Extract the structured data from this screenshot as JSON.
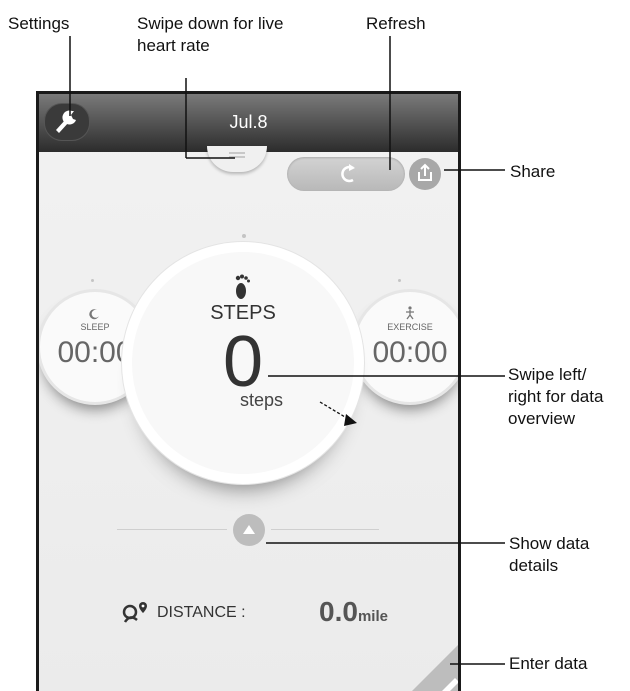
{
  "callouts": {
    "settings": "Settings",
    "swipe_down": "Swipe down for live",
    "swipe_down_2": "heart rate",
    "refresh": "Refresh",
    "share": "Share",
    "swipe_lr_1": "Swipe left/",
    "swipe_lr_2": "right for data",
    "swipe_lr_3": "overview",
    "details_1": "Show data",
    "details_2": "details",
    "enter_data": "Enter data"
  },
  "header": {
    "date": "Jul.8"
  },
  "metrics": {
    "sleep": {
      "label": "SLEEP",
      "value": "00:00"
    },
    "steps": {
      "label": "STEPS",
      "value": "0",
      "unit": "steps"
    },
    "exercise": {
      "label": "EXERCISE",
      "value": "00:00"
    }
  },
  "distance": {
    "label": "DISTANCE :",
    "value": "0.0",
    "unit": "mile"
  },
  "icons": {
    "settings": "wrench-icon",
    "refresh": "refresh-icon",
    "share": "share-icon",
    "sleep": "moon-icon",
    "steps": "footprint-icon",
    "exercise": "runner-icon",
    "details": "triangle-up-icon",
    "distance": "location-pin-icon",
    "edit": "pencil-icon"
  },
  "colors": {
    "header_dark": "#2c2c2c",
    "button_grey": "#bdbdbd"
  }
}
